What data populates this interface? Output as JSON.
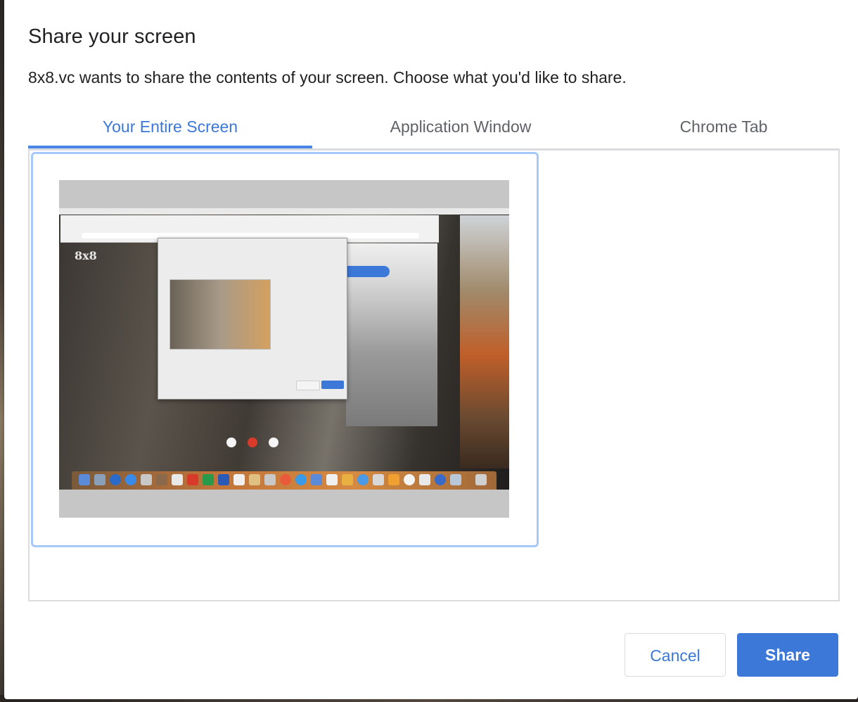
{
  "dialog": {
    "title": "Share your screen",
    "subtitle": "8x8.vc wants to share the contents of your screen. Choose what you'd like to share."
  },
  "tabs": [
    {
      "label": "Your Entire Screen",
      "active": true
    },
    {
      "label": "Application Window",
      "active": false
    },
    {
      "label": "Chrome Tab",
      "active": false
    }
  ],
  "preview": {
    "brand_text": "8x8"
  },
  "buttons": {
    "cancel_label": "Cancel",
    "share_label": "Share"
  },
  "colors": {
    "accent": "#3c78d8",
    "tile_border": "#a6c8fa",
    "panel_border": "#dadce0"
  }
}
